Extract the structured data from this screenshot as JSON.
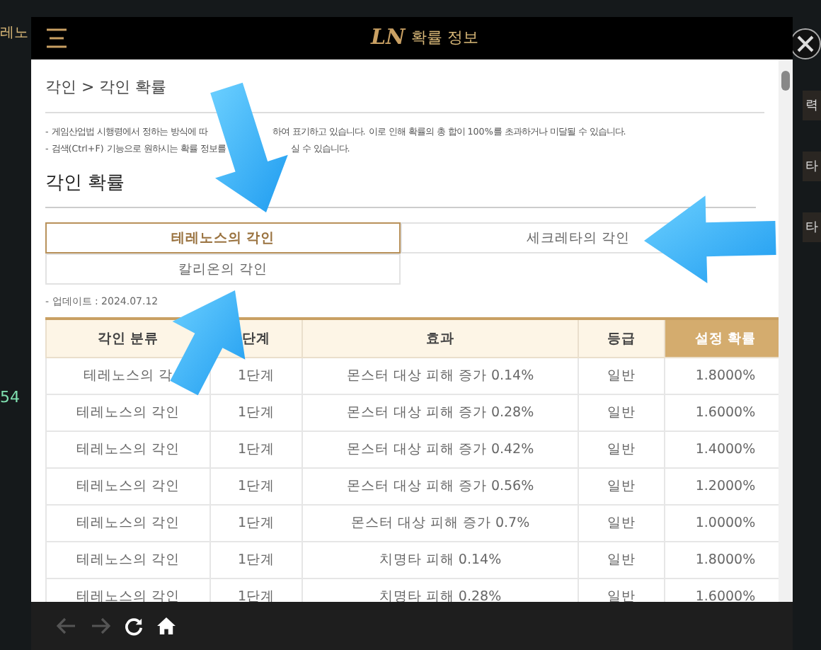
{
  "background": {
    "left_texts": [
      "레노",
      "54"
    ],
    "right_texts": [
      "력",
      "타",
      "타"
    ]
  },
  "window": {
    "title": "확률 정보",
    "logo": "LN"
  },
  "breadcrumb": "각인 > 각인 확률",
  "notices": [
    [
      "- 게임산업법 시행령에서 정하는 방식에 따",
      "하여 표기하고 있습니다. 이로 인해 확률의 총 합이 100%를 초과하거나 미달될 수 있습니다."
    ],
    [
      "- 검색(Ctrl+F) 기능으로 원하시는 확률 정보를",
      "실 수 있습니다."
    ]
  ],
  "heading": "각인 확률",
  "tabs": [
    {
      "label": "테레노스의 각인",
      "selected": true
    },
    {
      "label": "세크레타의 각인",
      "selected": false
    },
    {
      "label": "칼리온의 각인",
      "selected": false
    }
  ],
  "update": "- 업데이트 : 2024.07.12",
  "table": {
    "columns": [
      {
        "label": "각인 분류",
        "highlight": false
      },
      {
        "label": "단계",
        "highlight": false
      },
      {
        "label": "효과",
        "highlight": false
      },
      {
        "label": "등급",
        "highlight": false
      },
      {
        "label": "설정 확률",
        "highlight": true
      }
    ],
    "rows": [
      [
        "테레노스의 각",
        "1단계",
        "몬스터 대상 피해 증가 0.14%",
        "일반",
        "1.8000%"
      ],
      [
        "테레노스의 각인",
        "1단계",
        "몬스터 대상 피해 증가 0.28%",
        "일반",
        "1.6000%"
      ],
      [
        "테레노스의 각인",
        "1단계",
        "몬스터 대상 피해 증가 0.42%",
        "일반",
        "1.4000%"
      ],
      [
        "테레노스의 각인",
        "1단계",
        "몬스터 대상 피해 증가 0.56%",
        "일반",
        "1.2000%"
      ],
      [
        "테레노스의 각인",
        "1단계",
        "몬스터 대상 피해 증가 0.7%",
        "일반",
        "1.0000%"
      ],
      [
        "테레노스의 각인",
        "1단계",
        "치명타 피해 0.14%",
        "일반",
        "1.8000%"
      ],
      [
        "테레노스의 각인",
        "1단계",
        "치명타 피해 0.28%",
        "일반",
        "1.6000%"
      ]
    ]
  }
}
